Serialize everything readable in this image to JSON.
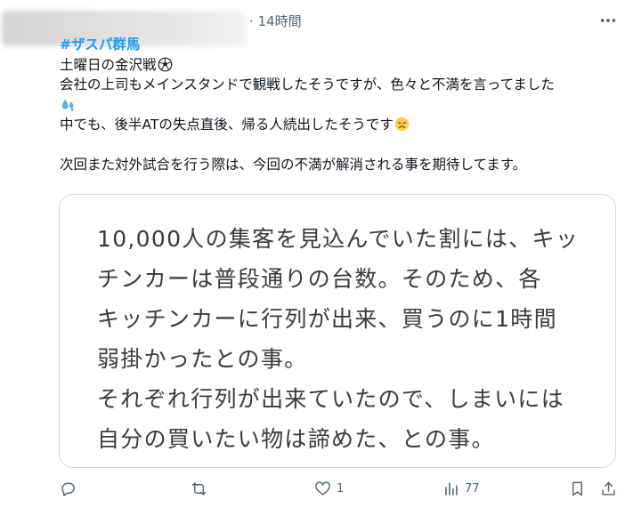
{
  "header": {
    "time_label": "· 14時間",
    "more_icon": "more-dots-icon"
  },
  "tweet": {
    "hashtag": "#ザスパ群馬",
    "line1": "土曜日の金沢戦",
    "line2": "会社の上司もメインスタンドで観戦したそうですが、色々と不満を言ってました",
    "line3": "中でも、後半ATの失点直後、帰る人続出したそうです",
    "line4": "次回また対外試合を行う際は、今回の不満が解消される事を期待してます。",
    "emojis": [
      "soccer-ball-icon",
      "sweat-droplets-icon",
      "disappointed-face-icon"
    ]
  },
  "card": {
    "lines": [
      "10,000人の集客を見込んでいた割には、キッ",
      "チンカーは普段通りの台数。そのため、各",
      "キッチンカーに行列が出来、買うのに1時間",
      "弱掛かったとの事。",
      "それぞれ行列が出来ていたので、しまいには",
      "自分の買いたい物は諦めた、との事。"
    ]
  },
  "actions": {
    "reply_count": "",
    "retweet_count": "",
    "like_count": "1",
    "views_count": "77"
  },
  "colors": {
    "hashtag": "#1d9bf0",
    "muted": "#536471",
    "border": "#cfd9de"
  }
}
